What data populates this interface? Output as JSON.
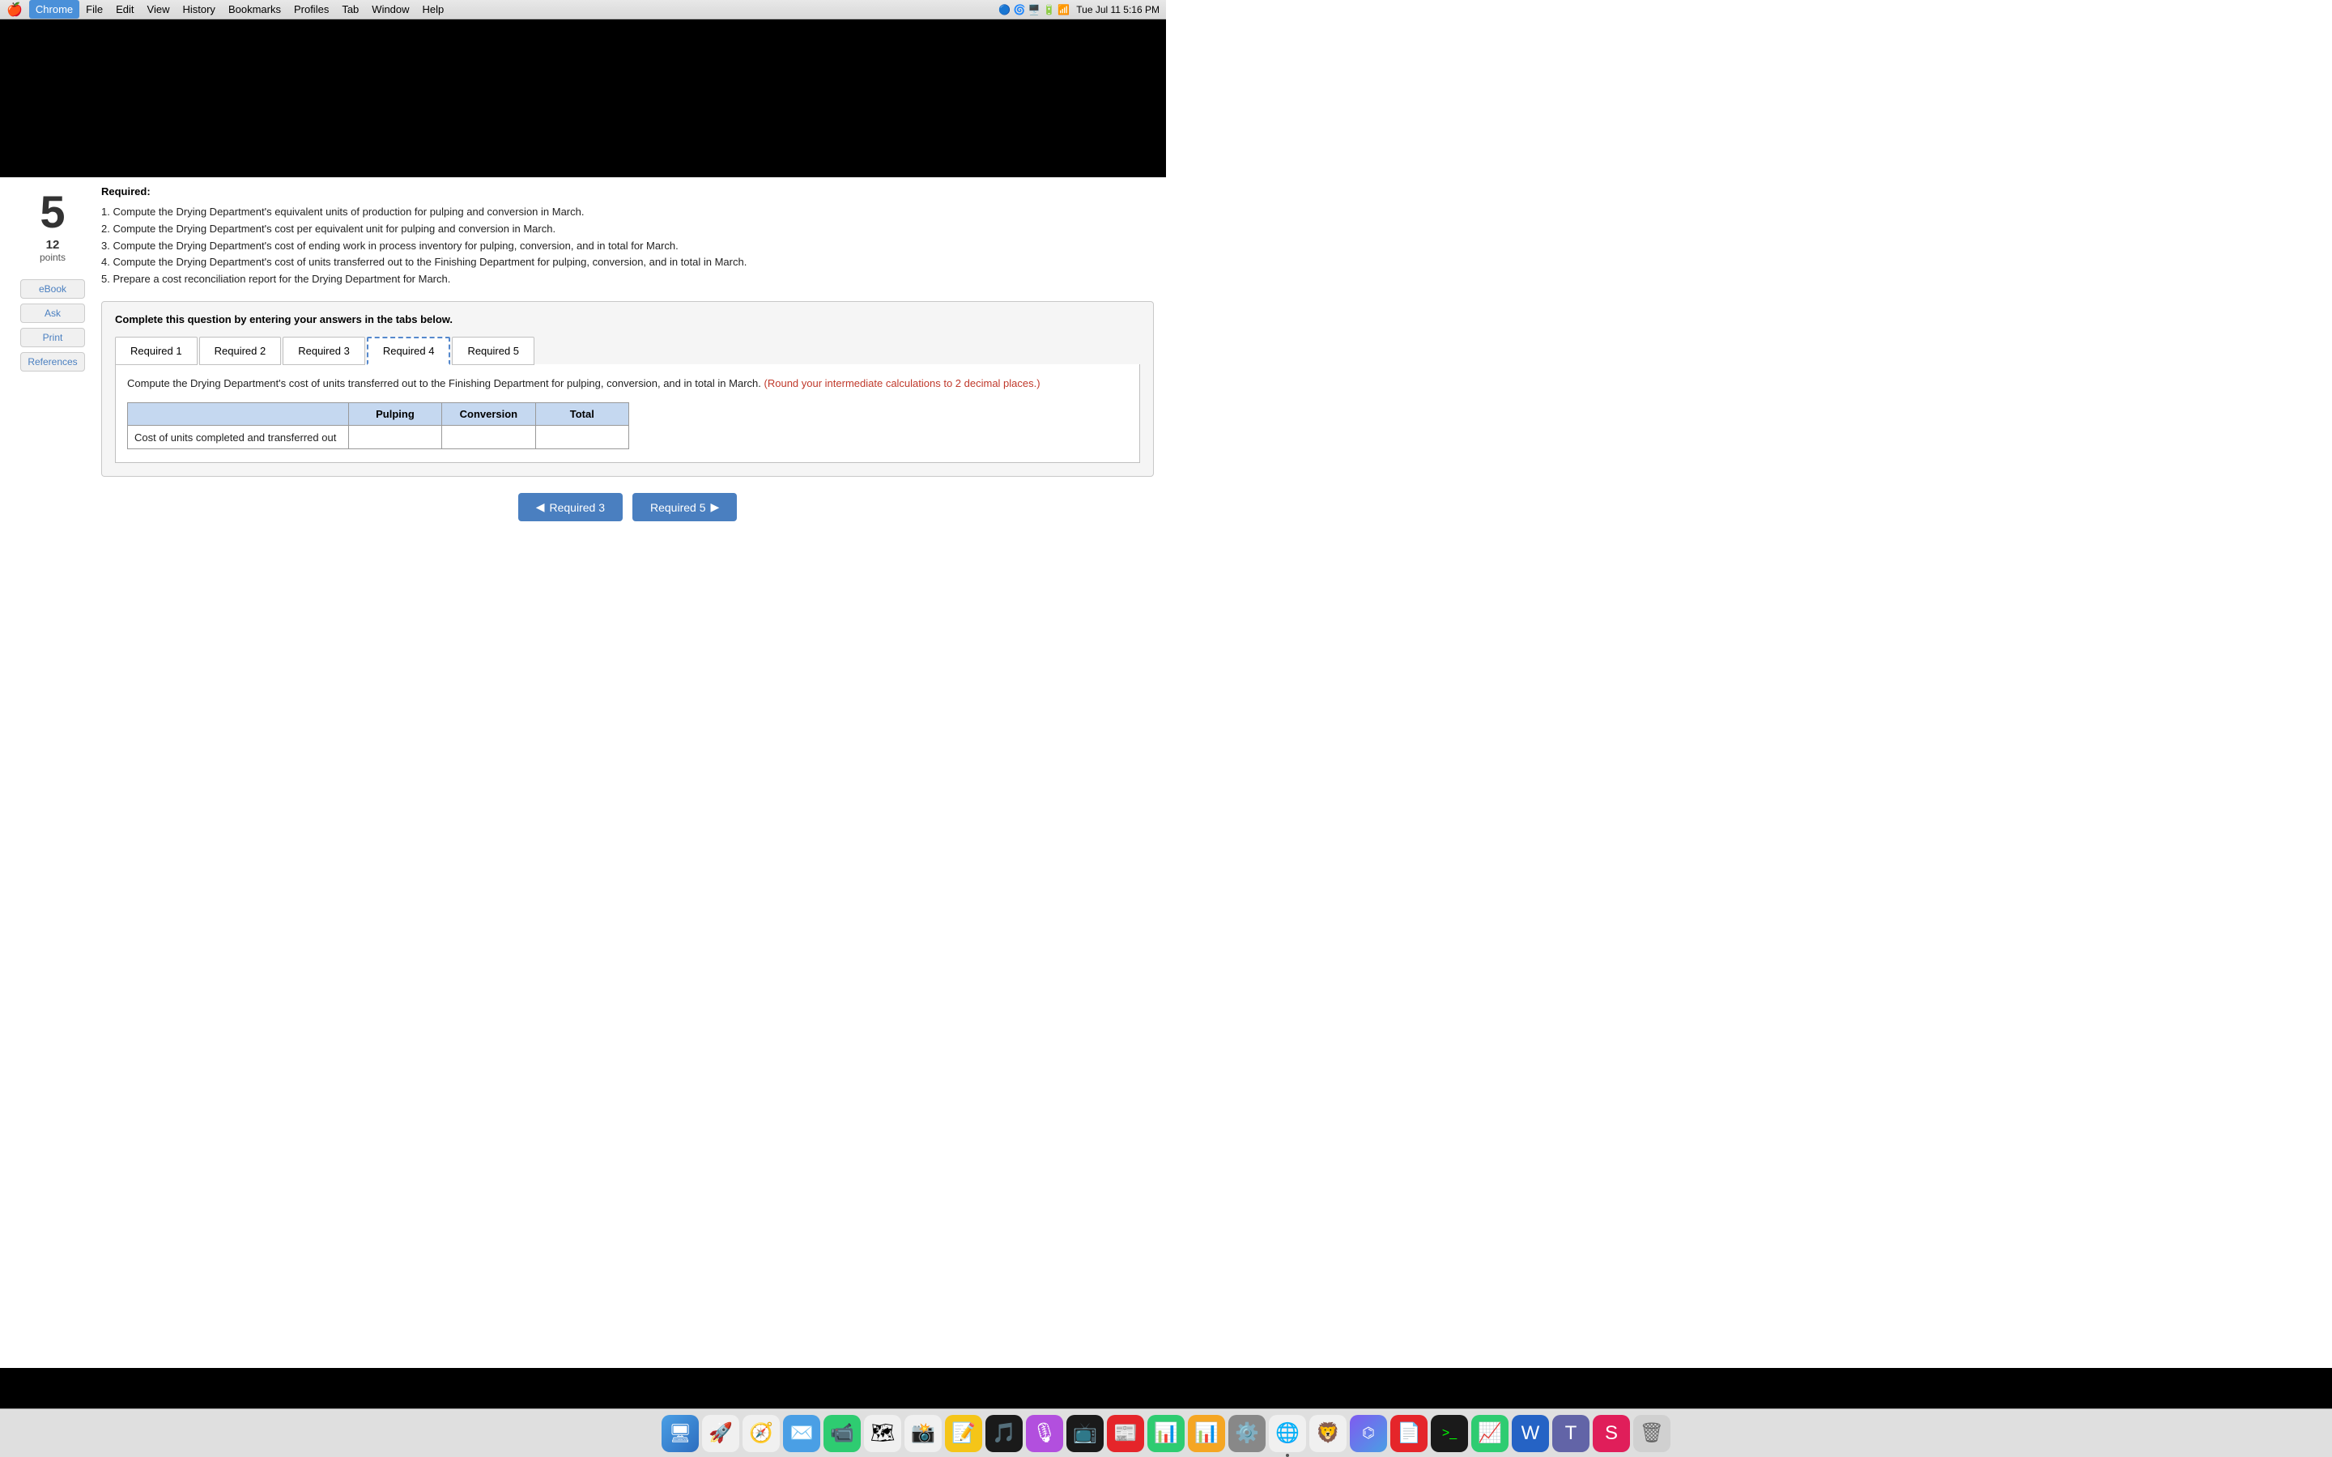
{
  "menubar": {
    "apple": "🍎",
    "items": [
      "Chrome",
      "File",
      "Edit",
      "View",
      "History",
      "Bookmarks",
      "Profiles",
      "Tab",
      "Window",
      "Help"
    ],
    "active_item": "Chrome",
    "time": "Tue Jul 11  5:16 PM"
  },
  "question": {
    "number": "5",
    "points_value": "12",
    "points_label": "points"
  },
  "sidebar_buttons": [
    {
      "label": "eBook"
    },
    {
      "label": "Ask"
    },
    {
      "label": "Print"
    },
    {
      "label": "References"
    }
  ],
  "required_label": "Required:",
  "required_list": [
    "1. Compute the Drying Department's equivalent units of production for pulping and conversion in March.",
    "2. Compute the Drying Department's cost per equivalent unit for pulping and conversion in March.",
    "3. Compute the Drying Department's cost of ending work in process inventory for pulping, conversion, and in total for March.",
    "4. Compute the Drying Department's cost of units transferred out to the Finishing Department for pulping, conversion, and in total in March.",
    "5. Prepare a cost reconciliation report for the Drying Department for March."
  ],
  "tab_section": {
    "instruction": "Complete this question by entering your answers in the tabs below.",
    "tabs": [
      {
        "label": "Required 1",
        "active": false
      },
      {
        "label": "Required 2",
        "active": false
      },
      {
        "label": "Required 3",
        "active": false
      },
      {
        "label": "Required 4",
        "active": true
      },
      {
        "label": "Required 5",
        "active": false
      }
    ],
    "content": {
      "description": "Compute the Drying Department's cost of units transferred out to the Finishing Department for pulping, conversion, and in total in March.",
      "note": "(Round your intermediate calculations to 2 decimal places.)",
      "table": {
        "headers": [
          "",
          "Pulping",
          "Conversion",
          "Total"
        ],
        "rows": [
          {
            "label": "Cost of units completed and transferred out",
            "pulping_value": "",
            "conversion_value": "",
            "total_value": ""
          }
        ]
      }
    }
  },
  "nav_buttons": {
    "prev_label": "Required 3",
    "next_label": "Required 5",
    "prev_arrow": "◀",
    "next_arrow": "▶"
  },
  "dock_icons": [
    {
      "emoji": "🔵",
      "label": "Finder",
      "color": "#4a9fe5"
    },
    {
      "emoji": "📱",
      "label": "Launchpad",
      "color": "#f5a623"
    },
    {
      "emoji": "🧭",
      "label": "Safari",
      "color": "#4a9fe5"
    },
    {
      "emoji": "📧",
      "label": "Mail",
      "color": "#4a9fe5"
    },
    {
      "emoji": "📷",
      "label": "FaceTime",
      "color": "#4a9fe5"
    },
    {
      "emoji": "🗺️",
      "label": "Maps",
      "color": "#4a9fe5"
    },
    {
      "emoji": "📸",
      "label": "Photos",
      "color": "#f5a623"
    },
    {
      "emoji": "📝",
      "label": "Notes",
      "color": "#f5c518"
    },
    {
      "emoji": "🎵",
      "label": "Music",
      "color": "#f5a623"
    },
    {
      "emoji": "🎙️",
      "label": "Podcasts",
      "color": "#b24fde"
    },
    {
      "emoji": "📺",
      "label": "TV",
      "color": "#4a9fe5"
    },
    {
      "emoji": "📰",
      "label": "News",
      "color": "#e5252a"
    },
    {
      "emoji": "📊",
      "label": "Numbers",
      "color": "#2ecc71"
    },
    {
      "emoji": "🗂️",
      "label": "Files",
      "color": "#4a9fe5"
    },
    {
      "emoji": "⚙️",
      "label": "SystemPrefs",
      "color": "#888"
    },
    {
      "emoji": "🌐",
      "label": "Chrome",
      "color": "#4a9fe5"
    },
    {
      "emoji": "🔵",
      "label": "Brave",
      "color": "#f5a623"
    },
    {
      "emoji": "🔵",
      "label": "Arc",
      "color": "#4a9fe5"
    },
    {
      "emoji": "📄",
      "label": "Acrobat",
      "color": "#e5252a"
    },
    {
      "emoji": "💻",
      "label": "Terminal",
      "color": "#333"
    },
    {
      "emoji": "📊",
      "label": "Excel",
      "color": "#2ecc71"
    },
    {
      "emoji": "📝",
      "label": "Word",
      "color": "#2563c5"
    },
    {
      "emoji": "📊",
      "label": "PowerPoint",
      "color": "#e5252a"
    },
    {
      "emoji": "🗑️",
      "label": "Trash",
      "color": "#888"
    }
  ]
}
